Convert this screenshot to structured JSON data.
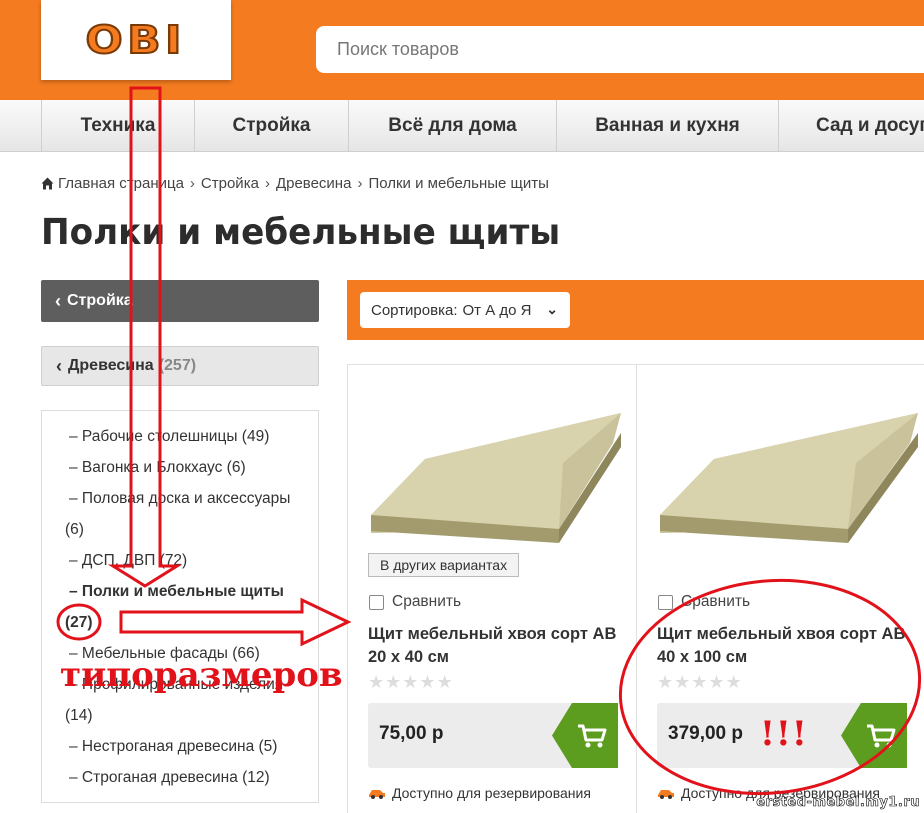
{
  "header": {
    "logo": "OBI",
    "search_placeholder": "Поиск товаров"
  },
  "nav": [
    {
      "label": "Техника"
    },
    {
      "label": "Стройка"
    },
    {
      "label": "Всё для дома"
    },
    {
      "label": "Ванная и кухня"
    },
    {
      "label": "Сад и досуг"
    }
  ],
  "breadcrumb": [
    {
      "label": "Главная страница"
    },
    {
      "label": "Стройка"
    },
    {
      "label": "Древесина"
    },
    {
      "label": "Полки и мебельные щиты"
    }
  ],
  "page_title": "Полки и мебельные щиты",
  "sidebar": {
    "back_primary": "Стройка",
    "back_secondary": {
      "label": "Древесина",
      "count": "(257)"
    },
    "categories": [
      {
        "line1": "– Рабочие столешницы (49)",
        "line2": ""
      },
      {
        "line1": "– Вагонка и Блокхаус (6)",
        "line2": ""
      },
      {
        "line1": "– Половая доска и аксессуары",
        "line2": "(6)"
      },
      {
        "line1": "– ДСП, ДВП (72)",
        "line2": ""
      },
      {
        "line1": "– Полки и мебельные щиты",
        "line2": "(27)"
      },
      {
        "line1": "– Мебельные фасады (66)",
        "line2": ""
      },
      {
        "line1": "– Профилированные изделия",
        "line2": "(14)"
      },
      {
        "line1": "– Нестроганая древесина (5)",
        "line2": ""
      },
      {
        "line1": "– Строганая древесина (12)",
        "line2": ""
      }
    ]
  },
  "sort": {
    "label": "Сортировка:",
    "value": "От А до Я"
  },
  "products": [
    {
      "variants_badge": "В других вариантах",
      "compare_label": "Сравнить",
      "name": "Щит мебельный хвоя сорт АВ 20 x 40 см",
      "rating": 0,
      "price": "75,00 р",
      "availability": "Доступно для резервирования"
    },
    {
      "variants_badge": "",
      "compare_label": "Сравнить",
      "name": "Щит мебельный хвоя сорт АВ 40 x 100 см",
      "rating": 0,
      "price": "379,00 р",
      "availability": "Доступно для резервирования"
    }
  ],
  "annotations": {
    "label": "типоразмеров",
    "exclamation": "!!!",
    "watermark": "ersted-mebel.my1.ru"
  },
  "colors": {
    "brand_orange": "#f47b20",
    "cart_green": "#5c9c1e",
    "annotation_red": "#e2121b"
  }
}
